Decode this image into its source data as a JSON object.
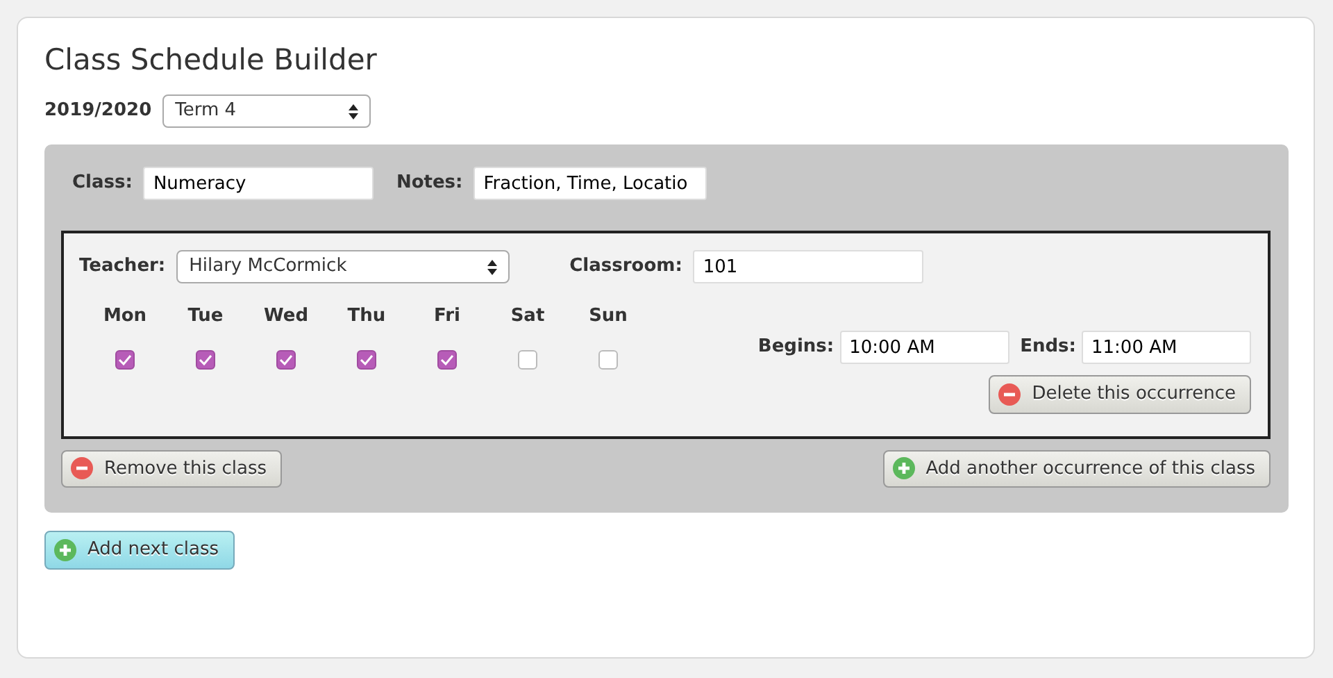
{
  "title": "Class Schedule Builder",
  "year": {
    "label": "2019/2020",
    "term": "Term 4"
  },
  "class_panel": {
    "class_label": "Class:",
    "class_value": "Numeracy",
    "notes_label": "Notes:",
    "notes_value": "Fraction, Time, Locatio",
    "occurrence": {
      "teacher_label": "Teacher:",
      "teacher": "Hilary McCormick",
      "classroom_label": "Classroom:",
      "classroom": "101",
      "days": [
        {
          "label": "Mon",
          "checked": true
        },
        {
          "label": "Tue",
          "checked": true
        },
        {
          "label": "Wed",
          "checked": true
        },
        {
          "label": "Thu",
          "checked": true
        },
        {
          "label": "Fri",
          "checked": true
        },
        {
          "label": "Sat",
          "checked": false
        },
        {
          "label": "Sun",
          "checked": false
        }
      ],
      "begins_label": "Begins:",
      "begins": "10:00 AM",
      "ends_label": "Ends:",
      "ends": "11:00 AM",
      "delete_button": {
        "label": "Delete this occurrence",
        "kind": "remove"
      }
    },
    "buttons": [
      {
        "label": "Remove this class",
        "kind": "remove"
      },
      {
        "label": "Add another occurrence of this class",
        "kind": "add"
      }
    ]
  },
  "next_button": {
    "label": "Add next class",
    "kind": "add"
  }
}
